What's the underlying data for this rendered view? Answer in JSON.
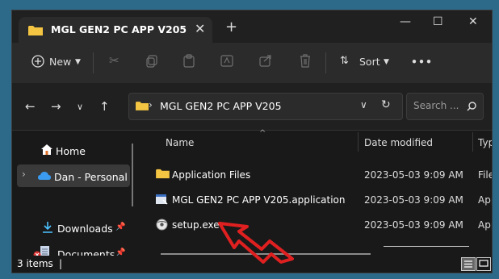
{
  "window": {
    "tab_title": "MGL GEN2 PC APP V205",
    "tab_close": "✕",
    "new_tab": "+",
    "minimize": "—",
    "maximize": "☐",
    "close": "✕"
  },
  "toolbar": {
    "new_label": "New",
    "sort_label": "Sort",
    "more": "•••"
  },
  "address": {
    "breadcrumb": "MGL GEN2 PC APP V205",
    "search_placeholder": "Search ..."
  },
  "nav": {
    "home": "Home",
    "personal": "Dan - Personal",
    "downloads": "Downloads",
    "documents": "Documents"
  },
  "columns": {
    "name": "Name",
    "date": "Date modified",
    "type": "Typ"
  },
  "files": [
    {
      "name": "Application Files",
      "date": "2023-05-03 9:09 AM",
      "type": "File",
      "icon": "folder-icon"
    },
    {
      "name": "MGL GEN2 PC APP V205.application",
      "date": "2023-05-03 9:09 AM",
      "type": "App",
      "icon": "application-manifest-icon"
    },
    {
      "name": "setup.exe",
      "date": "2023-05-03 9:09 AM",
      "type": "App",
      "icon": "setup-exe-icon"
    }
  ],
  "status": {
    "item_count": "3 items",
    "separator": "|"
  },
  "colors": {
    "background": "#2d6a8a",
    "window": "#191919",
    "folder": "#f4c542",
    "annotation_arrow": "#e02020"
  }
}
